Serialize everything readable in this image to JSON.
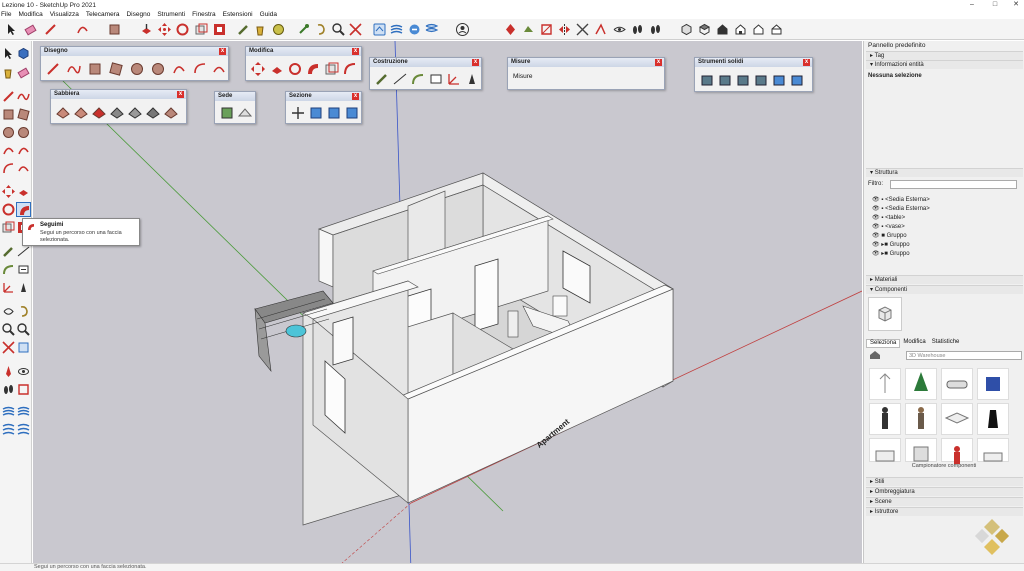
{
  "window": {
    "title": "Lezione 10 - SketchUp Pro 2021",
    "minimize": "–",
    "maximize": "□",
    "close": "✕"
  },
  "menu": [
    "File",
    "Modifica",
    "Visualizza",
    "Telecamera",
    "Disegno",
    "Strumenti",
    "Finestra",
    "Estensioni",
    "Guida"
  ],
  "colors": {
    "accent_red": "#c9302c",
    "brand_blue": "#2f6fbf",
    "viewport_bg": "#c9c8cf"
  },
  "panels": {
    "disegno": "Disegno",
    "modifica": "Modifica",
    "costruzione": "Costruzione",
    "misure": "Misure",
    "misure_value": "Misure",
    "strumenti_solidi": "Strumenti solidi",
    "sabbiera": "Sabbiera",
    "sede": "Sede",
    "sezione": "Sezione"
  },
  "tooltip": {
    "title": "Seguimi",
    "text_line1": "Segui un percorso con una faccia",
    "text_line2": "selezionata."
  },
  "model": {
    "label": "Apartment"
  },
  "right_panel": {
    "header": "Pannello predefinito",
    "tag": "Tag",
    "entity_info": "Informazioni entità",
    "selection": "Nessuna selezione",
    "structure": "Struttura",
    "filter_label": "Filtro:",
    "tree": [
      "<Sedia Esterna>",
      "<Sedia Esterna>",
      "<table>",
      "<vase>",
      "Gruppo",
      "Gruppo",
      "Gruppo"
    ],
    "materials": "Materiali",
    "components": "Componenti",
    "comp_tabs": [
      "Seleziona",
      "Modifica",
      "Statistiche"
    ],
    "search_placeholder": "3D Warehouse",
    "sampler": "Campionatore componenti",
    "styles": "Stili",
    "shadows": "Ombreggiatura",
    "scenes": "Scene",
    "instructor": "Istruttore"
  },
  "status": {
    "text": "Segui un percorso con una faccia selezionata."
  }
}
